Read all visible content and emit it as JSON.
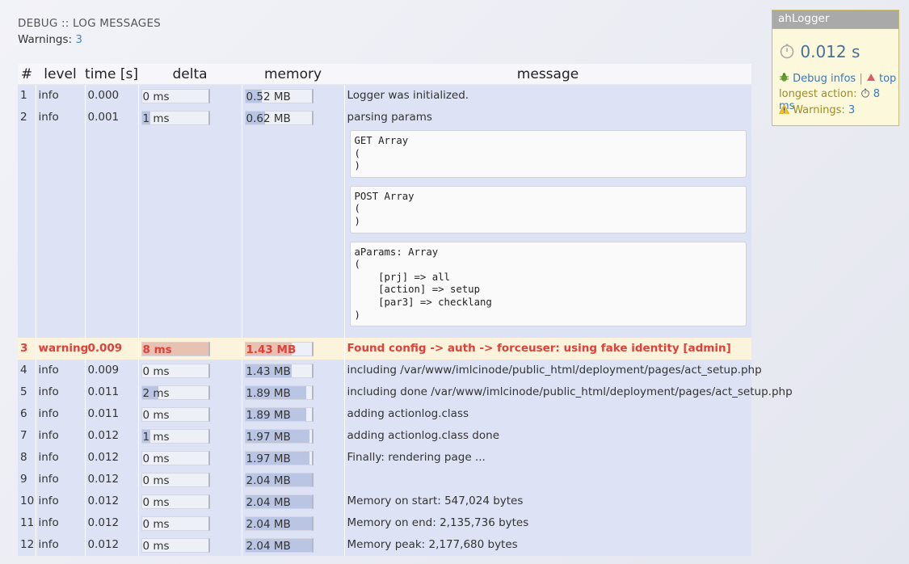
{
  "header": {
    "title": "DEBUG :: LOG MESSAGES",
    "warnings_label": "Warnings:",
    "warnings_count": "3"
  },
  "table": {
    "columns": [
      "#",
      "level",
      "time [s]",
      "delta",
      "memory",
      "message"
    ],
    "rows": [
      {
        "n": "1",
        "level": "info",
        "time": "0.000",
        "delta": "0 ms",
        "delta_frac": 0,
        "memory": "0.52 MB",
        "mem_frac": 0.255,
        "message": "Logger was initialized."
      },
      {
        "n": "2",
        "level": "info",
        "time": "0.001",
        "delta": "1 ms",
        "delta_frac": 0.125,
        "memory": "0.62 MB",
        "mem_frac": 0.304,
        "message": "parsing params",
        "dumps": [
          "GET Array\n(\n)",
          "POST Array\n(\n)",
          "aParams: Array\n(\n    [prj] => all\n    [action] => setup\n    [par3] => checklang\n)"
        ]
      },
      {
        "n": "3",
        "level": "warning",
        "time": "0.009",
        "delta": "8 ms",
        "delta_frac": 1,
        "memory": "1.43 MB",
        "mem_frac": 0.7,
        "message": "Found config -> auth -> forceuser: using fake identity [admin]",
        "warn": true
      },
      {
        "n": "4",
        "level": "info",
        "time": "0.009",
        "delta": "0 ms",
        "delta_frac": 0,
        "memory": "1.43 MB",
        "mem_frac": 0.7,
        "message": "including /var/www/imlcinode/public_html/deployment/pages/act_setup.php"
      },
      {
        "n": "5",
        "level": "info",
        "time": "0.011",
        "delta": "2 ms",
        "delta_frac": 0.25,
        "memory": "1.89 MB",
        "mem_frac": 0.926,
        "message": "including done /var/www/imlcinode/public_html/deployment/pages/act_setup.php"
      },
      {
        "n": "6",
        "level": "info",
        "time": "0.011",
        "delta": "0 ms",
        "delta_frac": 0,
        "memory": "1.89 MB",
        "mem_frac": 0.926,
        "message": "adding actionlog.class"
      },
      {
        "n": "7",
        "level": "info",
        "time": "0.012",
        "delta": "1 ms",
        "delta_frac": 0.125,
        "memory": "1.97 MB",
        "mem_frac": 0.966,
        "message": "adding actionlog.class done"
      },
      {
        "n": "8",
        "level": "info",
        "time": "0.012",
        "delta": "0 ms",
        "delta_frac": 0,
        "memory": "1.97 MB",
        "mem_frac": 0.966,
        "message": "Finally: rendering page ..."
      },
      {
        "n": "9",
        "level": "info",
        "time": "0.012",
        "delta": "0 ms",
        "delta_frac": 0,
        "memory": "2.04 MB",
        "mem_frac": 1,
        "message": "",
        "spacer": true
      },
      {
        "n": "10",
        "level": "info",
        "time": "0.012",
        "delta": "0 ms",
        "delta_frac": 0,
        "memory": "2.04 MB",
        "mem_frac": 1,
        "message": "Memory on start: 547,024 bytes"
      },
      {
        "n": "11",
        "level": "info",
        "time": "0.012",
        "delta": "0 ms",
        "delta_frac": 0,
        "memory": "2.04 MB",
        "mem_frac": 1,
        "message": "Memory on end: 2,135,736 bytes"
      },
      {
        "n": "12",
        "level": "info",
        "time": "0.012",
        "delta": "0 ms",
        "delta_frac": 0,
        "memory": "2.04 MB",
        "mem_frac": 1,
        "message": "Memory peak: 2,177,680 bytes"
      }
    ]
  },
  "logger": {
    "title": "ahLogger",
    "total_time": "0.012 s",
    "debug_link": "Debug infos",
    "separator": "|",
    "top_link": "top",
    "longest_label": "longest action:",
    "longest_value": "8 ms",
    "warnings_label": "Warnings:",
    "warnings_count": "3",
    "icons": [
      "stopwatch-icon",
      "bug-icon",
      "arrow-up-icon",
      "warning-icon"
    ]
  },
  "colors": {
    "row_bg": "#dde3f5",
    "warn_bg": "#fbf3dc",
    "warn_text": "#e0403a",
    "link": "#3a8ad6",
    "panel_bg": "#fbf8dc"
  }
}
